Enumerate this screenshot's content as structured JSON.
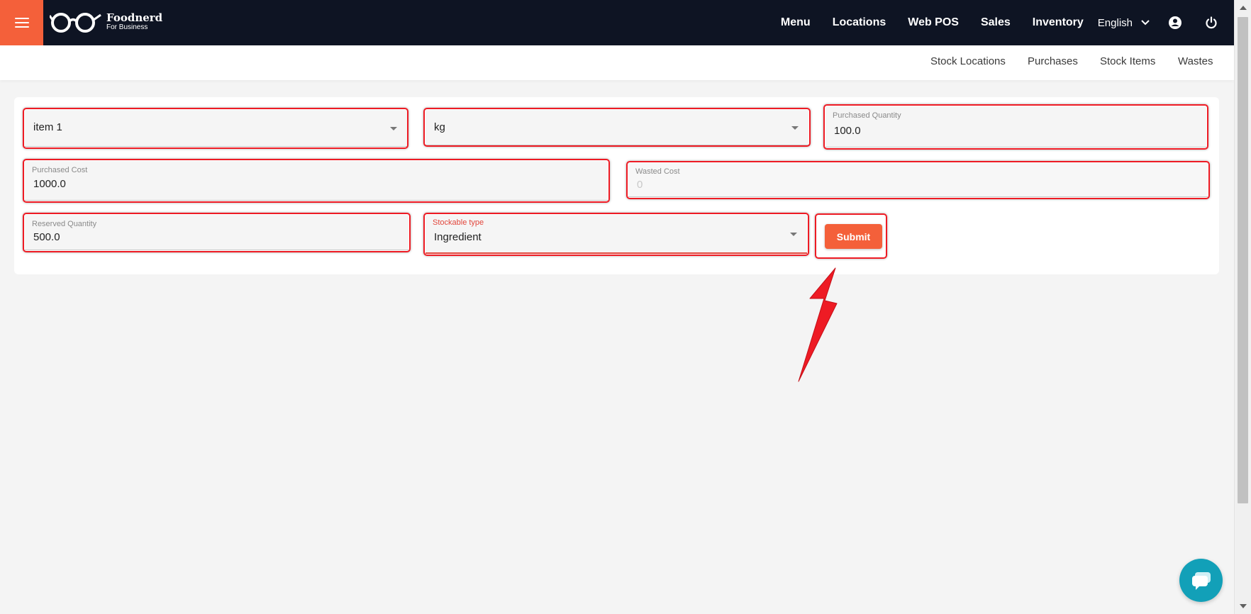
{
  "header": {
    "brand_title": "Foodnerd",
    "brand_subtitle": "For Business",
    "nav": [
      "Menu",
      "Locations",
      "Web POS",
      "Sales",
      "Inventory"
    ],
    "language": "English",
    "menu_icon": "hamburger-icon",
    "user_icon": "account-circle-icon",
    "power_icon": "power-icon"
  },
  "subnav": [
    "Stock Locations",
    "Purchases",
    "Stock Items",
    "Wastes"
  ],
  "form": {
    "item_select": "item 1",
    "unit_select": "kg",
    "purchased_quantity": {
      "label": "Purchased Quantity",
      "value": "100.0"
    },
    "purchased_cost": {
      "label": "Purchased Cost",
      "value": "1000.0"
    },
    "wasted_cost": {
      "label": "Wasted Cost",
      "value": "0"
    },
    "reserved_quantity": {
      "label": "Reserved Quantity",
      "value": "500.0"
    },
    "stockable_type": {
      "label": "Stockable type",
      "value": "Ingredient"
    },
    "submit_label": "Submit"
  },
  "colors": {
    "header_bg": "#0e1423",
    "accent": "#f4603a",
    "highlight": "#ee1b24",
    "chat": "#12a0b8"
  }
}
